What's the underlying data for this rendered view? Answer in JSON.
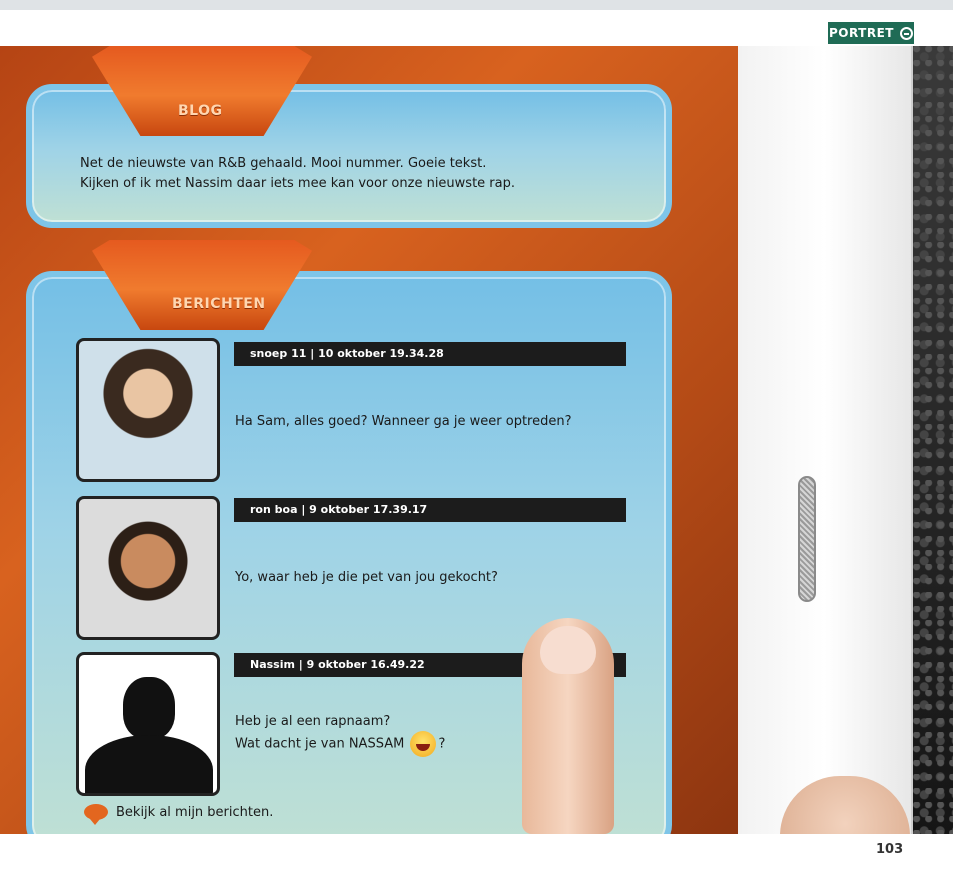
{
  "header": {
    "section_label": "PORTRET"
  },
  "blog": {
    "title": "BLOG",
    "text_line1": "Net de nieuwste van R&B gehaald. Mooi nummer. Goeie tekst.",
    "text_line2": "Kijken of ik met Nassim daar iets mee kan voor onze nieuwste rap."
  },
  "messages": {
    "title": "BERICHTEN",
    "items": [
      {
        "header": "snoep 11 | 10 oktober  19.34.28",
        "text_line1": "Ha Sam, alles goed? Wanneer ga je weer optreden?"
      },
      {
        "header": "ron boa | 9 oktober  17.39.17",
        "text_line1": "Yo, waar heb je die pet van jou gekocht?"
      },
      {
        "header": "Nassim | 9 oktober  16.49.22",
        "text_line1": "Heb je al een rapnaam?",
        "text_line2_a": "Wat dacht je van NASSAM",
        "text_line2_b": "?"
      }
    ],
    "more_link": "Bekijk al mijn berichten."
  },
  "footer": {
    "page_number": "103"
  }
}
